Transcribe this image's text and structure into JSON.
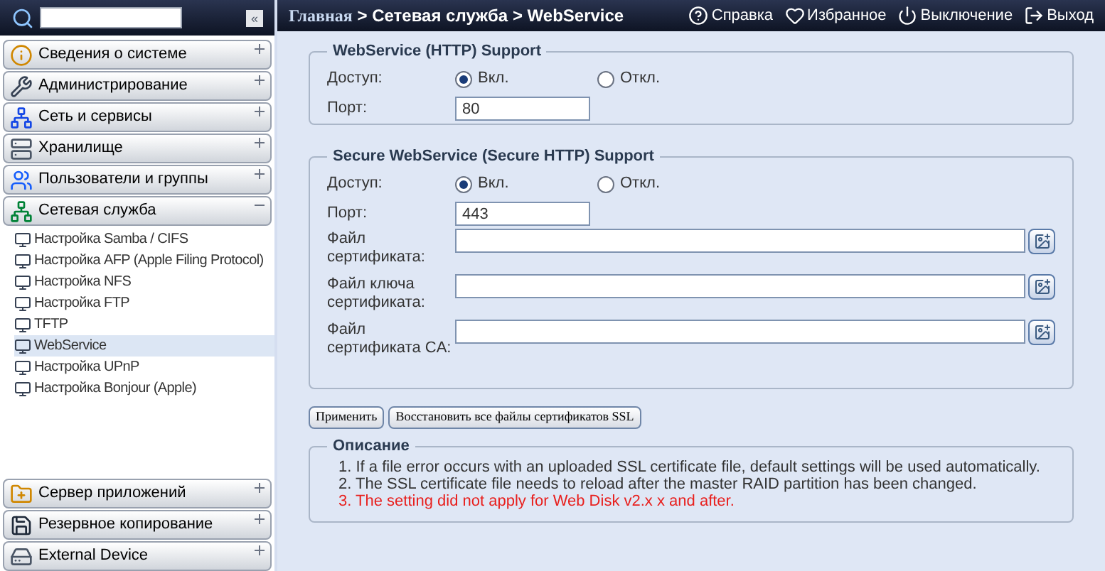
{
  "sidebar": {
    "collapse_button": "«",
    "sections_top": [
      {
        "label": "Сведения о системе",
        "expanded": false
      },
      {
        "label": "Администрирование",
        "expanded": false
      },
      {
        "label": "Сеть и сервисы",
        "expanded": false
      },
      {
        "label": "Хранилище",
        "expanded": false
      },
      {
        "label": "Пользователи и группы",
        "expanded": false
      },
      {
        "label": "Сетевая служба",
        "expanded": true,
        "children": [
          {
            "label": "Настройка Samba / CIFS",
            "selected": false
          },
          {
            "label": "Настройка AFP (Apple Filing Protocol)",
            "selected": false
          },
          {
            "label": "Настройка NFS",
            "selected": false
          },
          {
            "label": "Настройка FTP",
            "selected": false
          },
          {
            "label": "TFTP",
            "selected": false
          },
          {
            "label": "WebService",
            "selected": true
          },
          {
            "label": "Настройка UPnP",
            "selected": false
          },
          {
            "label": "Настройка Bonjour (Apple)",
            "selected": false
          }
        ]
      }
    ],
    "sections_bottom": [
      {
        "label": "Сервер приложений",
        "expanded": false
      },
      {
        "label": "Резервное копирование",
        "expanded": false
      },
      {
        "label": "External Device",
        "expanded": false
      }
    ]
  },
  "header": {
    "breadcrumb": {
      "home": "Главная",
      "path": "> Сетевая служба > WebService"
    },
    "actions": [
      {
        "label": "Справка",
        "kind": "help"
      },
      {
        "label": "Избранное",
        "kind": "favorite"
      },
      {
        "label": "Выключение",
        "kind": "power"
      },
      {
        "label": "Выход",
        "kind": "logout"
      }
    ]
  },
  "http": {
    "title": "WebService (HTTP) Support",
    "access_label": "Доступ:",
    "options": [
      {
        "label": "Вкл.",
        "selected": true
      },
      {
        "label": "Откл.",
        "selected": false
      }
    ],
    "port_label": "Порт:",
    "port": "80"
  },
  "https": {
    "title": "Secure WebService (Secure HTTP) Support",
    "access_label": "Доступ:",
    "options": [
      {
        "label": "Вкл.",
        "selected": true
      },
      {
        "label": "Откл.",
        "selected": false
      }
    ],
    "port_label": "Порт:",
    "port": "443",
    "files": [
      {
        "label": "Файл сертификата:"
      },
      {
        "label": "Файл ключа сертификата:"
      },
      {
        "label": "Файл сертификата CA:"
      }
    ]
  },
  "buttons": [
    "Применить",
    "Восстановить все файлы сертификатов SSL"
  ],
  "description": {
    "title": "Описание",
    "notes": [
      {
        "text": "1. If a file error occurs with an uploaded SSL certificate file, default settings will be used automatically.",
        "kind": "info"
      },
      {
        "text": "2. The SSL certificate file needs to reload after the master RAID partition has been changed.",
        "kind": "info"
      },
      {
        "text": "3. The setting did not apply for Web Disk v2.x x and after.",
        "kind": "warning"
      }
    ]
  }
}
